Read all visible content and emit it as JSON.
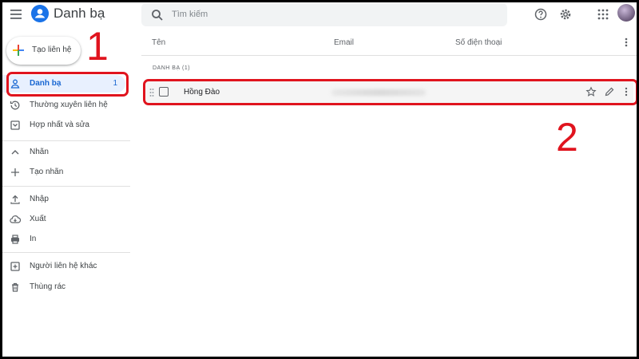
{
  "app": {
    "title": "Danh bạ"
  },
  "search": {
    "placeholder": "Tìm kiếm"
  },
  "create": {
    "label": "Tạo liên hệ"
  },
  "nav": [
    {
      "label": "Danh bạ",
      "count": "1"
    },
    {
      "label": "Thường xuyên liên hệ"
    },
    {
      "label": "Hợp nhất và sửa"
    },
    {
      "label": "Nhãn"
    },
    {
      "label": "Tạo nhãn"
    },
    {
      "label": "Nhập"
    },
    {
      "label": "Xuất"
    },
    {
      "label": "In"
    },
    {
      "label": "Người liên hệ khác"
    },
    {
      "label": "Thùng rác"
    }
  ],
  "table": {
    "columns": [
      "Tên",
      "Email",
      "Số điện thoại"
    ],
    "section": "DANH BẠ (1)",
    "rows": [
      {
        "name": "Hồng Đào"
      }
    ]
  },
  "annotations": {
    "label1": "1",
    "label2": "2",
    "color": "#e0141e"
  },
  "colors": {
    "accent": "#1a73e8",
    "active_bg": "#e8f0fe",
    "active_text": "#1967d2"
  }
}
